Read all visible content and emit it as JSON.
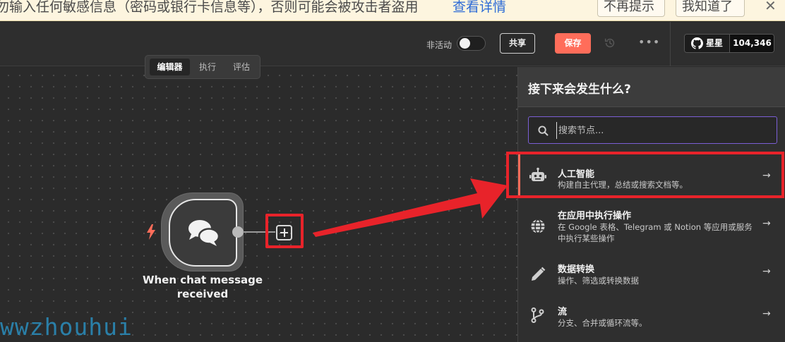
{
  "banner": {
    "text": "勿输入任何敏感信息（密码或银行卡信息等），否则可能会被攻击者盗用",
    "link": "查看详情",
    "dismiss_label": "不再提示",
    "gotit_label": "我知道了",
    "close_icon": "close-icon"
  },
  "header": {
    "inactive_label": "非活动",
    "share_label": "共享",
    "save_label": "保存",
    "more_label": "•••",
    "github_label": "星星",
    "github_count": "104,346"
  },
  "canvas": {
    "tabs": [
      {
        "label": "编辑器",
        "active": true
      },
      {
        "label": "执行",
        "active": false
      },
      {
        "label": "评估",
        "active": false
      }
    ],
    "node_title": "When chat message received",
    "watermark": "wwzhouhui"
  },
  "panel": {
    "title": "接下来会发生什么?",
    "search_placeholder": "搜索节点...",
    "items": [
      {
        "icon": "robot-icon",
        "title": "人工智能",
        "desc": "构建自主代理，总结或搜索文档等。"
      },
      {
        "icon": "globe-icon",
        "title": "在应用中执行操作",
        "desc": "在 Google 表格、Telegram 或 Notion 等应用或服务中执行某些操作"
      },
      {
        "icon": "pen-icon",
        "title": "数据转换",
        "desc": "操作、筛选或转换数据"
      },
      {
        "icon": "flow-branch-icon",
        "title": "流",
        "desc": "分支、合并或循环流等。"
      }
    ],
    "arrow_glyph": "→"
  },
  "colors": {
    "accent": "#ff6d5a",
    "highlight_red": "#e8232a",
    "search_border": "#7b5fd6"
  }
}
